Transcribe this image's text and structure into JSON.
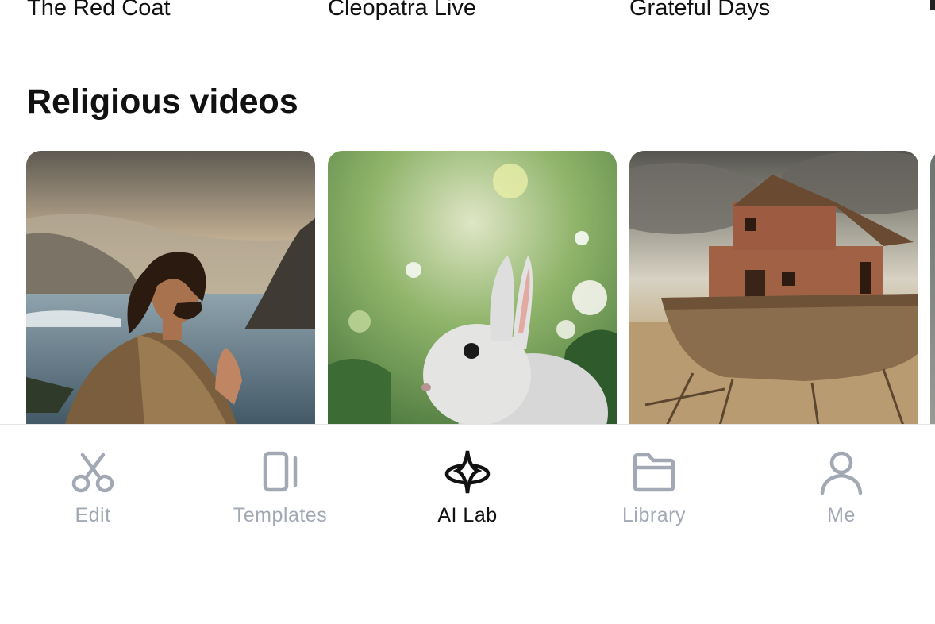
{
  "previous_row": {
    "titles": [
      "The Red Coat",
      "Cleopatra Live",
      "Grateful Days"
    ]
  },
  "section": {
    "title": "Religious videos",
    "cards": [
      {
        "subject": "man praying by the sea at sunset"
      },
      {
        "subject": "white rabbit in a green garden"
      },
      {
        "subject": "wooden ark on scaffolding"
      }
    ]
  },
  "tabbar": {
    "tabs": [
      {
        "label": "Edit",
        "icon": "scissors-icon",
        "active": false
      },
      {
        "label": "Templates",
        "icon": "templates-icon",
        "active": false
      },
      {
        "label": "AI Lab",
        "icon": "ai-sparkle-orbit-icon",
        "active": true
      },
      {
        "label": "Library",
        "icon": "folder-icon",
        "active": false
      },
      {
        "label": "Me",
        "icon": "person-icon",
        "active": false
      }
    ]
  },
  "colors": {
    "active_tab": "#111111",
    "inactive_tab": "#a2a9b4",
    "background": "#ffffff"
  }
}
